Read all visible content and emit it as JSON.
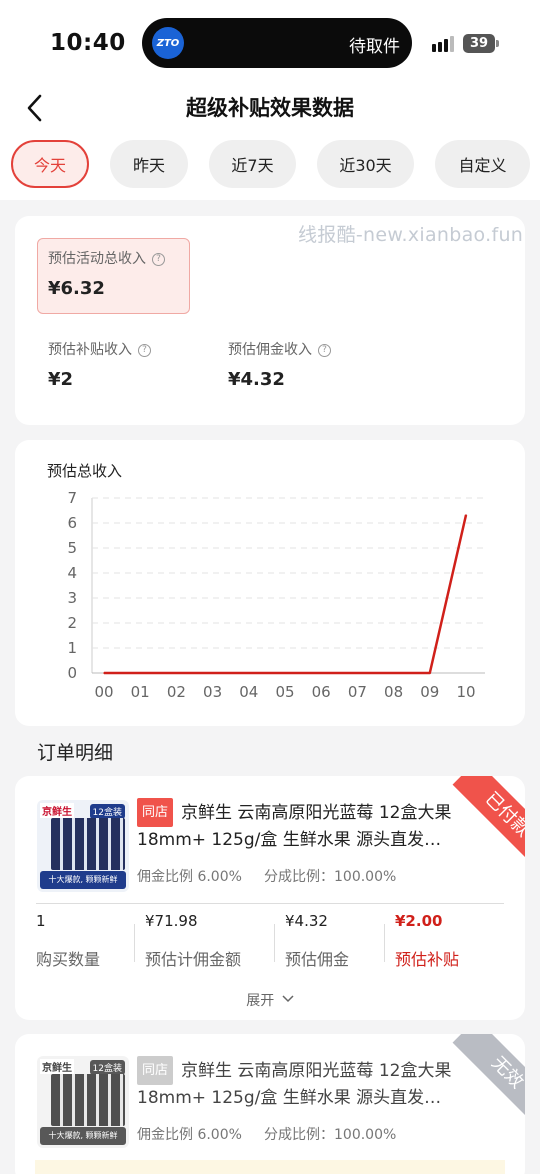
{
  "status_bar": {
    "time": "10:40",
    "island_app": "ZTO",
    "island_text": "待取件",
    "battery": "39"
  },
  "nav": {
    "title": "超级补贴效果数据"
  },
  "tabs": [
    {
      "label": "今天",
      "active": true
    },
    {
      "label": "昨天",
      "active": false
    },
    {
      "label": "近7天",
      "active": false
    },
    {
      "label": "近30天",
      "active": false
    },
    {
      "label": "自定义",
      "active": false
    }
  ],
  "watermark": "线报酷-new.xianbao.fun",
  "summary": {
    "total_label": "预估活动总收入",
    "total_value": "¥6.32",
    "subsidy_label": "预估补贴收入",
    "subsidy_value": "¥2",
    "commission_label": "预估佣金收入",
    "commission_value": "¥4.32"
  },
  "chart_title": "预估总收入",
  "chart_data": {
    "type": "line",
    "title": "预估总收入",
    "x": [
      "00",
      "01",
      "02",
      "03",
      "04",
      "05",
      "06",
      "07",
      "08",
      "09",
      "10"
    ],
    "series": [
      {
        "values": [
          0,
          0,
          0,
          0,
          0,
          0,
          0,
          0,
          0,
          0,
          6.32
        ]
      }
    ],
    "y_ticks": [
      "0",
      "1",
      "2",
      "3",
      "4",
      "5",
      "6",
      "7"
    ],
    "ylim": [
      0,
      7
    ],
    "grid": true,
    "line_color": "#d0201a"
  },
  "orders_title": "订单明细",
  "orders": [
    {
      "thumb_brand": "京鲜生",
      "thumb_badge": "12盒装",
      "thumb_banner": "十大爆款, 颗颗新鲜",
      "store_tag": "同店",
      "title": "京鲜生 云南高原阳光蓝莓 12盒大果18mm+ 125g/盒 生鲜水果 源头直发…",
      "commission_rate": "佣金比例 6.00%",
      "share_rate": "分成比例：100.00%",
      "status": "已付款",
      "status_color": "#f0534b",
      "stats": [
        {
          "value": "1",
          "label": "购买数量"
        },
        {
          "value": "¥71.98",
          "label": "预估计佣金额"
        },
        {
          "value": "¥4.32",
          "label": "预估佣金"
        },
        {
          "value": "¥2.00",
          "label": "预估补贴"
        }
      ],
      "expand_label": "展开"
    },
    {
      "thumb_brand": "京鲜生",
      "thumb_badge": "12盒装",
      "thumb_banner": "十大爆款, 颗颗新鲜",
      "store_tag": "同店",
      "title": "京鲜生 云南高原阳光蓝莓 12盒大果18mm+ 125g/盒 生鲜水果 源头直发…",
      "commission_rate": "佣金比例 6.00%",
      "share_rate": "分成比例：100.00%",
      "status": "无效",
      "status_color": "#b9bcc3"
    }
  ]
}
